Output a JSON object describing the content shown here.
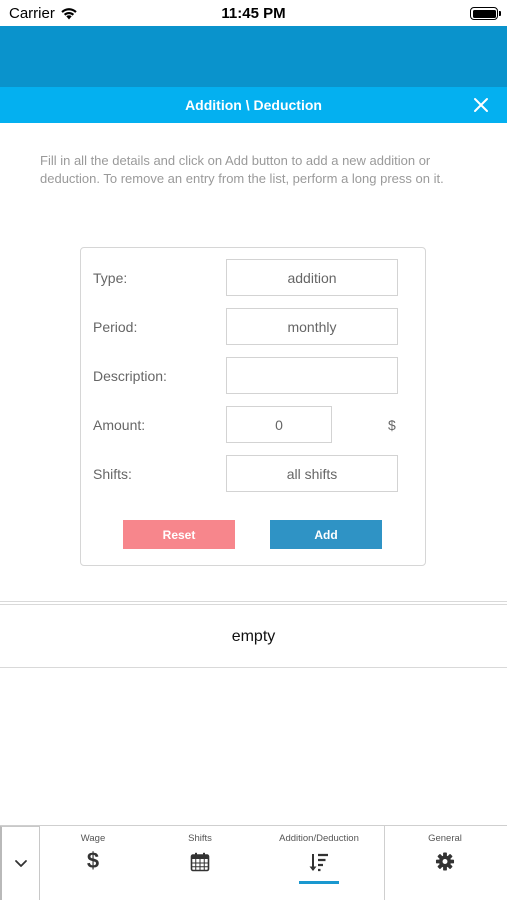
{
  "status_bar": {
    "carrier": "Carrier",
    "time": "11:45 PM"
  },
  "dialog": {
    "title": "Addition \\ Deduction",
    "close_icon": "close-icon",
    "instructions": "Fill in all the details and click on Add button to add a new addition or deduction. To remove an entry from the list, perform a long press on it."
  },
  "form": {
    "type": {
      "label": "Type:",
      "value": "addition"
    },
    "period": {
      "label": "Period:",
      "value": "monthly"
    },
    "description": {
      "label": "Description:",
      "value": ""
    },
    "amount": {
      "label": "Amount:",
      "value": "0",
      "currency": "$"
    },
    "shifts": {
      "label": "Shifts:",
      "value": "all shifts"
    },
    "reset_label": "Reset",
    "add_label": "Add"
  },
  "list": {
    "empty_text": "empty"
  },
  "tab_bar": {
    "active_tab": "Addition/Deduction",
    "tabs": [
      {
        "label": "Wage",
        "icon": "dollar-icon"
      },
      {
        "label": "Shifts",
        "icon": "calendar-icon"
      },
      {
        "label": "Addition/Deduction",
        "icon": "sort-icon"
      },
      {
        "label": "General",
        "icon": "gear-icon"
      }
    ]
  },
  "colors": {
    "header_dark": "#0a93cc",
    "header_light": "#04b0f0",
    "reset_button": "#f7868c",
    "add_button": "#2f93c5",
    "active_tab_underline": "#1a98cf"
  }
}
